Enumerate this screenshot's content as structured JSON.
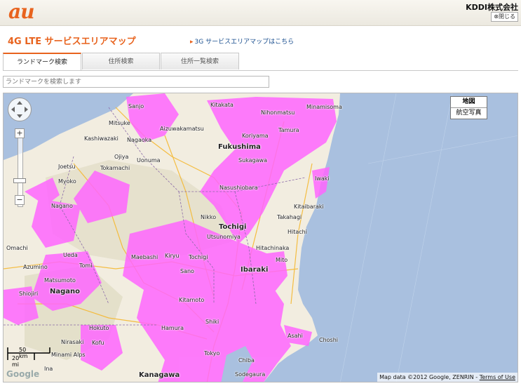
{
  "header": {
    "logo": "au",
    "company": "KDDI株式会社",
    "close_label": "閉じる"
  },
  "page": {
    "title": "4G LTE サービスエリアマップ",
    "link_3g": "3G サービスエリアマップはこちら"
  },
  "tabs": [
    {
      "label": "ランドマーク検索",
      "active": true
    },
    {
      "label": "住所検索",
      "active": false
    },
    {
      "label": "住所一覧検索",
      "active": false
    }
  ],
  "search": {
    "placeholder": "ランドマークを検索します"
  },
  "map": {
    "type_options": [
      "地図",
      "航空写真"
    ],
    "selected_type": "地図",
    "attribution": "Map data ©2012 Google, ZENRIN - ",
    "terms": "Terms of Use",
    "scale_km": "50 km",
    "scale_mi": "20 mi",
    "google": "Google",
    "coverage_color": "#ff66ff",
    "sea_color": "#a9c0df",
    "labels": {
      "sanjo": "Sanjo",
      "kitakata": "Kitakata",
      "nihonmatsu": "Nihonmatsu",
      "minamisoma": "Minamisoma",
      "mitsuke": "Mitsuke",
      "aizuwakamatsu": "Aizuwakamatsu",
      "koriyama": "Koriyama",
      "tamura": "Tamura",
      "nagaoka": "Nagaoka",
      "kashiwazaki": "Kashiwazaki",
      "fukushima": "Fukushima",
      "ojiya": "Ojiya",
      "uonuma": "Uonuma",
      "sukagawa": "Sukagawa",
      "tokamachi": "Tokamachi",
      "joetsu": "Joetsu",
      "myoko": "Myoko",
      "nasushiobara": "Nasushiobara",
      "iwaki": "Iwaki",
      "kitaibaraki": "Kitaibaraki",
      "takahagi": "Takahagi",
      "nikko": "Nikko",
      "nagano_city": "Nagano",
      "tochigi": "Tochigi",
      "hitachi": "Hitachi",
      "utsunomiya": "Utsunomiya",
      "omachi": "Omachi",
      "maebashi": "Maebashi",
      "kiryu": "Kiryu",
      "hitachinaka": "Hitachinaka",
      "ueda": "Ueda",
      "tochigi_city": "Tochigi",
      "mito": "Mito",
      "azumino": "Azumino",
      "tomi": "Tomi",
      "sano": "Sano",
      "ibaraki": "Ibaraki",
      "matsumoto": "Matsumoto",
      "shiojiri": "Shiojiri",
      "nagano": "Nagano",
      "kitamoto": "Kitamoto",
      "hamura": "Hamura",
      "shiki": "Shiki",
      "hokuto": "Hokuto",
      "kofu": "Kofu",
      "tokyo": "Tokyo",
      "asahi": "Asahi",
      "nirasaki": "Nirasaki",
      "minamialps": "Minami Alps",
      "choshi": "Choshi",
      "kanagawa": "Kanagawa",
      "chiba": "Chiba",
      "ina": "Ina",
      "sodegaura": "Sodegaura"
    }
  }
}
